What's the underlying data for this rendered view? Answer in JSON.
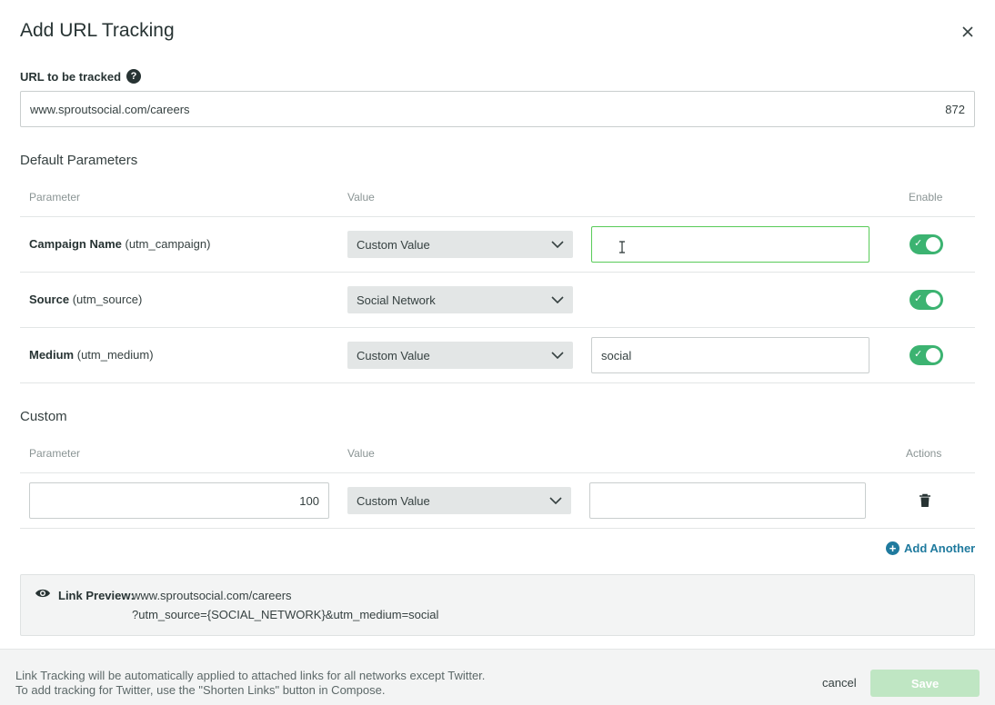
{
  "modal": {
    "title": "Add URL Tracking",
    "close_icon": "close-icon"
  },
  "url": {
    "label": "URL to be tracked",
    "help_glyph": "?",
    "value": "www.sproutsocial.com/careers",
    "char_count": "872"
  },
  "default_params": {
    "title": "Default Parameters",
    "headers": {
      "parameter": "Parameter",
      "value": "Value",
      "enable": "Enable"
    },
    "rows": [
      {
        "name": "Campaign Name",
        "key": "(utm_campaign)",
        "select": "Custom Value",
        "input": "",
        "enabled": true
      },
      {
        "name": "Source",
        "key": "(utm_source)",
        "select": "Social Network",
        "enabled": true
      },
      {
        "name": "Medium",
        "key": "(utm_medium)",
        "select": "Custom Value",
        "input": "social",
        "enabled": true
      }
    ]
  },
  "custom": {
    "title": "Custom",
    "headers": {
      "parameter": "Parameter",
      "value": "Value",
      "actions": "Actions"
    },
    "row": {
      "param_count": "100",
      "select": "Custom Value",
      "input": ""
    },
    "add_another": "Add Another"
  },
  "preview": {
    "label": "Link Preview:",
    "url_line1": "www.sproutsocial.com/careers",
    "url_line2": "?utm_source={SOCIAL_NETWORK}&utm_medium=social"
  },
  "footer": {
    "note_line1": "Link Tracking will be automatically applied to attached links for all networks except Twitter.",
    "note_line2": "To add tracking for Twitter, use the \"Shorten Links\" button in Compose.",
    "cancel": "cancel",
    "save": "Save"
  },
  "colors": {
    "toggle_on": "#3cb371",
    "focus_border": "#59cb59",
    "link": "#1f7a9e",
    "save_disabled": "#bfe6c3"
  }
}
